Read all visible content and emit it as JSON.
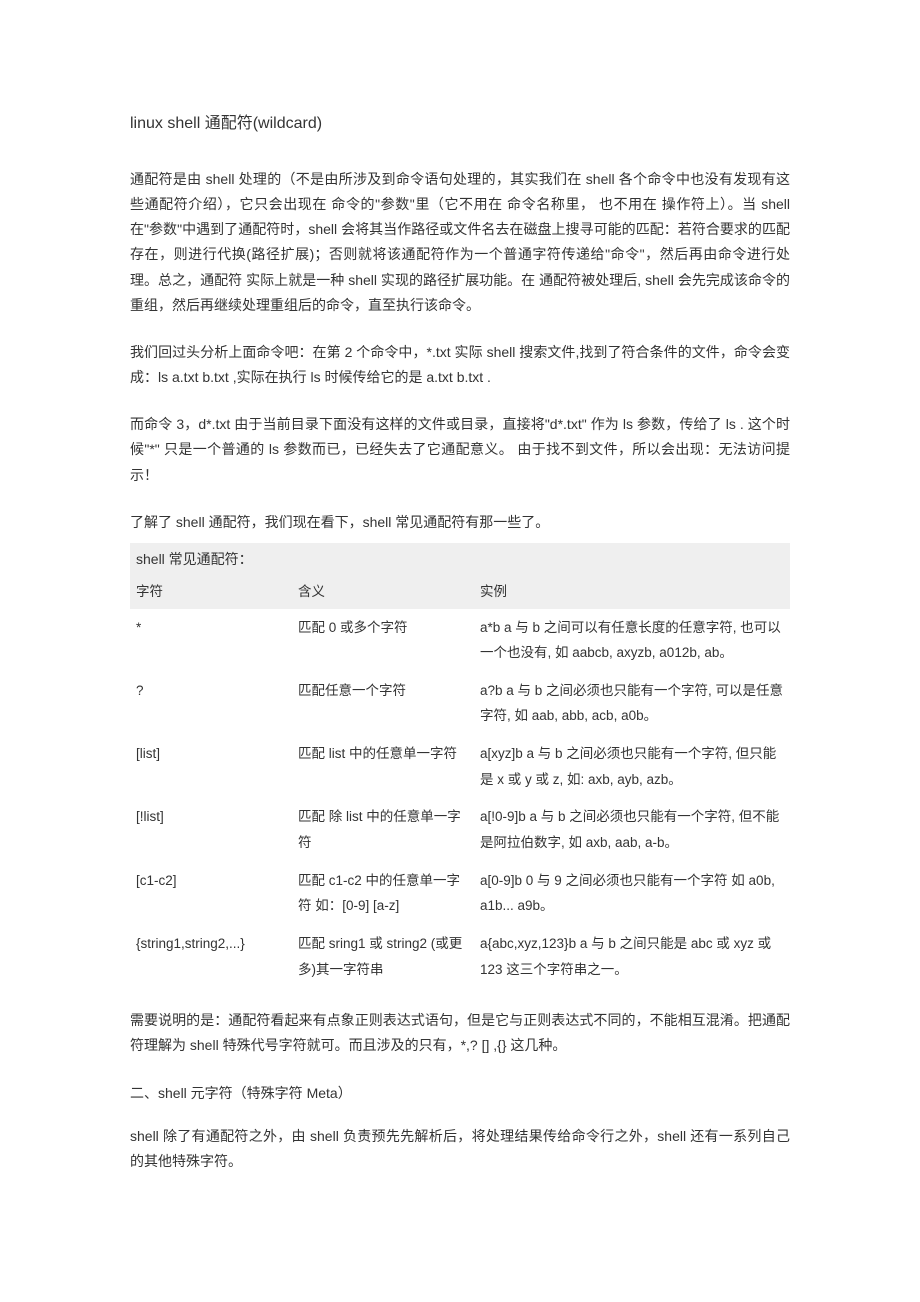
{
  "title": "linux shell 通配符(wildcard)",
  "para1": "通配符是由 shell 处理的（不是由所涉及到命令语句处理的，其实我们在 shell 各个命令中也没有发现有这些通配符介绍），它只会出现在 命令的\"参数\"里（它不用在 命令名称里， 也不用在 操作符上）。当 shell 在\"参数\"中遇到了通配符时，shell 会将其当作路径或文件名去在磁盘上搜寻可能的匹配：若符合要求的匹配存在，则进行代换(路径扩展)；否则就将该通配符作为一个普通字符传递给\"命令\"，然后再由命令进行处理。总之，通配符 实际上就是一种 shell 实现的路径扩展功能。在 通配符被处理后, shell 会先完成该命令的重组，然后再继续处理重组后的命令，直至执行该命令。",
  "para2": "我们回过头分析上面命令吧：在第 2 个命令中，*.txt 实际 shell 搜索文件,找到了符合条件的文件，命令会变成：ls a.txt b.txt ,实际在执行 ls 时候传给它的是 a.txt b.txt .",
  "para3": "而命令 3，d*.txt 由于当前目录下面没有这样的文件或目录，直接将\"d*.txt\" 作为 ls 参数，传给了 ls . 这个时候\"*\" 只是一个普通的 ls 参数而已，已经失去了它通配意义。 由于找不到文件，所以会出现：无法访问提示！",
  "para4": "了解了 shell 通配符，我们现在看下，shell 常见通配符有那一些了。",
  "tableTitle": "shell 常见通配符：",
  "headers": {
    "c1": "字符",
    "c2": "含义",
    "c3": "实例"
  },
  "rows": [
    {
      "c1": "*",
      "c2": "匹配 0 或多个字符",
      "c3": "a*b a 与 b 之间可以有任意长度的任意字符, 也可以一个也没有, 如 aabcb, axyzb, a012b, ab。"
    },
    {
      "c1": "?",
      "c2": "匹配任意一个字符",
      "c3": "a?b a 与 b 之间必须也只能有一个字符, 可以是任意字符, 如 aab, abb, acb, a0b。"
    },
    {
      "c1": "[list]",
      "c2": "匹配 list 中的任意单一字符",
      "c3": "a[xyz]b  a 与 b 之间必须也只能有一个字符, 但只能是 x 或 y 或 z, 如: axb, ayb, azb。"
    },
    {
      "c1": "[!list]",
      "c2": "匹配 除 list 中的任意单一字符",
      "c3": "a[!0-9]b a 与 b 之间必须也只能有一个字符, 但不能是阿拉伯数字, 如 axb, aab, a-b。"
    },
    {
      "c1": "[c1-c2]",
      "c2": "匹配 c1-c2 中的任意单一字符 如：[0-9] [a-z]",
      "c3": "a[0-9]b 0 与 9 之间必须也只能有一个字符 如 a0b, a1b... a9b。"
    },
    {
      "c1": "{string1,string2,...}",
      "c2": "匹配 sring1 或 string2 (或更多)其一字符串",
      "c3": "a{abc,xyz,123}b  a 与 b 之间只能是 abc 或 xyz 或 123 这三个字符串之一。"
    }
  ],
  "para5": "需要说明的是：通配符看起来有点象正则表达式语句，但是它与正则表达式不同的，不能相互混淆。把通配符理解为 shell 特殊代号字符就可。而且涉及的只有，*,? [] ,{} 这几种。",
  "sectionHead": "二、shell 元字符（特殊字符 Meta）",
  "para6": "shell 除了有通配符之外，由 shell 负责预先先解析后，将处理结果传给命令行之外，shell 还有一系列自己的其他特殊字符。"
}
